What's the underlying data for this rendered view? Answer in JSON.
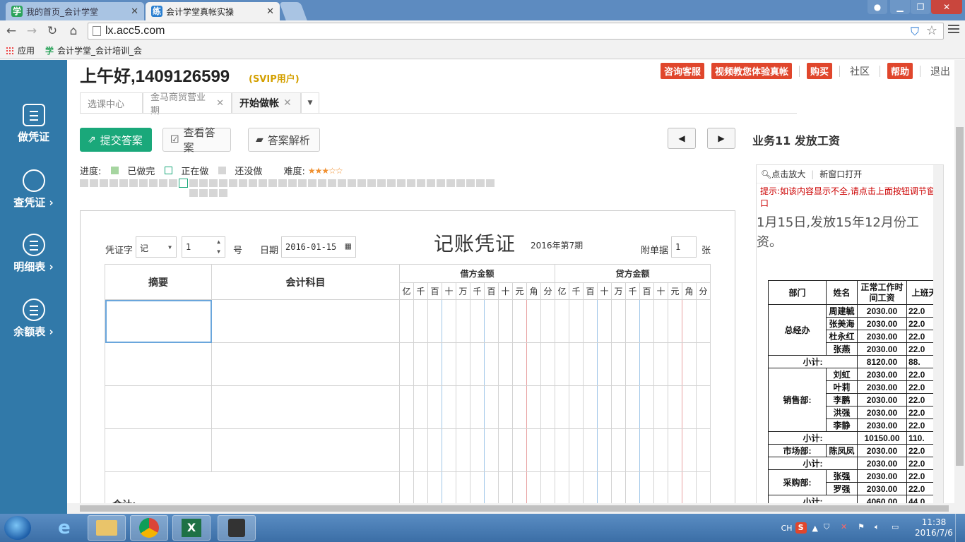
{
  "browser": {
    "tabs": [
      {
        "title": "我的首页_会计学堂",
        "favicon": "学"
      },
      {
        "title": "会计学堂真帐实操",
        "favicon": "练"
      }
    ],
    "url": "lx.acc5.com",
    "bookmarks": [
      {
        "label": "应用"
      },
      {
        "label": "会计学堂_会计培训_会"
      }
    ]
  },
  "sidebar": {
    "items": [
      {
        "label": "做凭证",
        "icon": "calculator-icon"
      },
      {
        "label": "查凭证 ›",
        "icon": "search-icon"
      },
      {
        "label": "明细表 ›",
        "icon": "list-icon"
      },
      {
        "label": "余额表 ›",
        "icon": "list-icon"
      }
    ]
  },
  "header": {
    "greeting": "上午好,1409126599",
    "user_badge": "(SVIP用户)",
    "links": {
      "service": "咨询客服",
      "video": "视频教您体验真帐",
      "buy": "购买",
      "community": "社区",
      "help": "帮助",
      "logout": "退出"
    }
  },
  "page_tabs": [
    {
      "label": "选课中心"
    },
    {
      "label": "金马商贸营业期"
    },
    {
      "label": "开始做帐"
    }
  ],
  "actions": {
    "submit": "提交答案",
    "view": "查看答案",
    "analysis": "答案解析"
  },
  "business_title": "业务11  发放工资",
  "progress": {
    "label": "进度:",
    "done": "已做完",
    "doing": "正在做",
    "todo": "还没做",
    "difficulty": "难度:",
    "difficulty_stars": 3,
    "difficulty_max": 5,
    "total_items": 46,
    "current_item": 11
  },
  "voucher": {
    "word_label": "凭证字",
    "word_value": "记",
    "number_value": "1",
    "number_unit": "号",
    "date_label": "日期",
    "date_value": "2016-01-15",
    "title": "记账凭证",
    "period": "2016年第7期",
    "attach_label": "附单据",
    "attach_value": "1",
    "attach_unit": "张",
    "col_summary": "摘要",
    "col_account": "会计科目",
    "debit_label": "借方金额",
    "credit_label": "贷方金额",
    "digits": [
      "亿",
      "千",
      "百",
      "十",
      "万",
      "千",
      "百",
      "十",
      "元",
      "角",
      "分"
    ],
    "total_label": "合计:"
  },
  "right_panel": {
    "zoom": "点击放大",
    "new_window": "新窗口打开",
    "hint": "提示:如该内容显示不全,请点击上面按钮调节窗口",
    "description": "1月15日,发放15年12月份工资。",
    "table_headers": [
      "部门",
      "姓名",
      "正常工作时间工资",
      "上班天"
    ],
    "rows": [
      {
        "dept": "总经办",
        "name": "周建毓",
        "salary": "2030.00",
        "days": "22.0"
      },
      {
        "dept": "",
        "name": "张美海",
        "salary": "2030.00",
        "days": "22.0"
      },
      {
        "dept": "",
        "name": "杜永红",
        "salary": "2030.00",
        "days": "22.0"
      },
      {
        "dept": "",
        "name": "张燕",
        "salary": "2030.00",
        "days": "22.0"
      },
      {
        "subtotal": "小计:",
        "salary": "8120.00",
        "days": "88."
      },
      {
        "dept": "销售部:",
        "name": "刘虹",
        "salary": "2030.00",
        "days": "22.0"
      },
      {
        "dept": "",
        "name": "叶莉",
        "salary": "2030.00",
        "days": "22.0"
      },
      {
        "dept": "",
        "name": "李鹏",
        "salary": "2030.00",
        "days": "22.0"
      },
      {
        "dept": "",
        "name": "洪强",
        "salary": "2030.00",
        "days": "22.0"
      },
      {
        "dept": "",
        "name": "李静",
        "salary": "2030.00",
        "days": "22.0"
      },
      {
        "subtotal": "小计:",
        "salary": "10150.00",
        "days": "110."
      },
      {
        "dept": "市场部:",
        "name": "陈凤凤",
        "salary": "2030.00",
        "days": "22.0"
      },
      {
        "subtotal": "小计:",
        "salary": "2030.00",
        "days": "22.0"
      },
      {
        "dept": "采购部:",
        "name": "张强",
        "salary": "2030.00",
        "days": "22.0"
      },
      {
        "dept": "",
        "name": "罗强",
        "salary": "2030.00",
        "days": "22.0"
      },
      {
        "subtotal": "小计:",
        "salary": "4060.00",
        "days": "44.0"
      }
    ]
  },
  "taskbar": {
    "lang": "CH",
    "time": "11:38",
    "date": "2016/7/6"
  },
  "colors": {
    "sidebar": "#3179a9",
    "submit_green": "#1aa87a",
    "link_red": "#e0462c",
    "svip": "#d4a000"
  }
}
